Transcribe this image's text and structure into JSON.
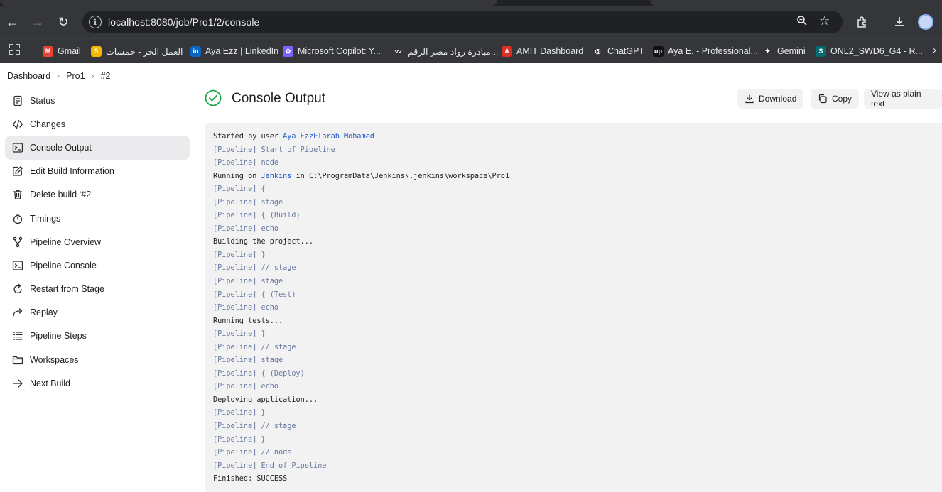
{
  "browser": {
    "url": "localhost:8080/job/Pro1/2/console",
    "bookmarks": [
      {
        "label": "Gmail",
        "fav": "M",
        "color": "#ea4335"
      },
      {
        "label": "العمل الحر - خمسات",
        "fav": "5",
        "color": "#f6b700"
      },
      {
        "label": "Aya Ezz | LinkedIn",
        "fav": "in",
        "color": "#0a66c2"
      },
      {
        "label": "Microsoft Copilot: Y...",
        "fav": "✿",
        "color": "#7b61ff"
      },
      {
        "label": "مبادرة رواد مصر الرقم...",
        "fav": "〰",
        "color": "#35363a"
      },
      {
        "label": "AMIT Dashboard",
        "fav": "A",
        "color": "#d93025"
      },
      {
        "label": "ChatGPT",
        "fav": "◎",
        "color": "#35363a"
      },
      {
        "label": "Aya E. - Professional...",
        "fav": "up",
        "color": "#111111"
      },
      {
        "label": "Gemini",
        "fav": "✦",
        "color": "#35363a"
      },
      {
        "label": "ONL2_SWD6_G4 - R...",
        "fav": "S",
        "color": "#036c70"
      }
    ]
  },
  "breadcrumb": {
    "dashboard": "Dashboard",
    "job": "Pro1",
    "build": "#2"
  },
  "sidebar": {
    "items": [
      {
        "label": "Status",
        "icon": "status-icon",
        "active": false
      },
      {
        "label": "Changes",
        "icon": "code-icon",
        "active": false
      },
      {
        "label": "Console Output",
        "icon": "terminal-icon",
        "active": true
      },
      {
        "label": "Edit Build Information",
        "icon": "edit-icon",
        "active": false
      },
      {
        "label": "Delete build ‘#2’",
        "icon": "trash-icon",
        "active": false
      },
      {
        "label": "Timings",
        "icon": "stopwatch-icon",
        "active": false
      },
      {
        "label": "Pipeline Overview",
        "icon": "branch-icon",
        "active": false
      },
      {
        "label": "Pipeline Console",
        "icon": "terminal-icon",
        "active": false
      },
      {
        "label": "Restart from Stage",
        "icon": "restart-icon",
        "active": false
      },
      {
        "label": "Replay",
        "icon": "replay-icon",
        "active": false
      },
      {
        "label": "Pipeline Steps",
        "icon": "list-icon",
        "active": false
      },
      {
        "label": "Workspaces",
        "icon": "folder-icon",
        "active": false
      },
      {
        "label": "Next Build",
        "icon": "arrow-right-icon",
        "active": false
      }
    ]
  },
  "main": {
    "title": "Console Output",
    "buttons": {
      "download": "Download",
      "copy": "Copy",
      "plain": "View as plain text"
    },
    "console_lines": [
      {
        "parts": [
          {
            "t": "Started by user ",
            "c": ""
          },
          {
            "t": "Aya EzzElarab Mohamed",
            "c": "link"
          }
        ]
      },
      {
        "parts": [
          {
            "t": "[Pipeline] Start of Pipeline",
            "c": "pipe"
          }
        ]
      },
      {
        "parts": [
          {
            "t": "[Pipeline] node",
            "c": "pipe"
          }
        ]
      },
      {
        "parts": [
          {
            "t": "Running on ",
            "c": ""
          },
          {
            "t": "Jenkins",
            "c": "link"
          },
          {
            "t": " in C:\\ProgramData\\Jenkins\\.jenkins\\workspace\\Pro1",
            "c": ""
          }
        ]
      },
      {
        "parts": [
          {
            "t": "[Pipeline] {",
            "c": "pipe"
          }
        ]
      },
      {
        "parts": [
          {
            "t": "[Pipeline] stage",
            "c": "pipe"
          }
        ]
      },
      {
        "parts": [
          {
            "t": "[Pipeline] { (Build)",
            "c": "pipe"
          }
        ]
      },
      {
        "parts": [
          {
            "t": "[Pipeline] echo",
            "c": "pipe"
          }
        ]
      },
      {
        "parts": [
          {
            "t": "Building the project...",
            "c": ""
          }
        ]
      },
      {
        "parts": [
          {
            "t": "[Pipeline] }",
            "c": "pipe"
          }
        ]
      },
      {
        "parts": [
          {
            "t": "[Pipeline] // stage",
            "c": "pipe"
          }
        ]
      },
      {
        "parts": [
          {
            "t": "[Pipeline] stage",
            "c": "pipe"
          }
        ]
      },
      {
        "parts": [
          {
            "t": "[Pipeline] { (Test)",
            "c": "pipe"
          }
        ]
      },
      {
        "parts": [
          {
            "t": "[Pipeline] echo",
            "c": "pipe"
          }
        ]
      },
      {
        "parts": [
          {
            "t": "Running tests...",
            "c": ""
          }
        ]
      },
      {
        "parts": [
          {
            "t": "[Pipeline] }",
            "c": "pipe"
          }
        ]
      },
      {
        "parts": [
          {
            "t": "[Pipeline] // stage",
            "c": "pipe"
          }
        ]
      },
      {
        "parts": [
          {
            "t": "[Pipeline] stage",
            "c": "pipe"
          }
        ]
      },
      {
        "parts": [
          {
            "t": "[Pipeline] { (Deploy)",
            "c": "pipe"
          }
        ]
      },
      {
        "parts": [
          {
            "t": "[Pipeline] echo",
            "c": "pipe"
          }
        ]
      },
      {
        "parts": [
          {
            "t": "Deploying application...",
            "c": ""
          }
        ]
      },
      {
        "parts": [
          {
            "t": "[Pipeline] }",
            "c": "pipe"
          }
        ]
      },
      {
        "parts": [
          {
            "t": "[Pipeline] // stage",
            "c": "pipe"
          }
        ]
      },
      {
        "parts": [
          {
            "t": "[Pipeline] }",
            "c": "pipe"
          }
        ]
      },
      {
        "parts": [
          {
            "t": "[Pipeline] // node",
            "c": "pipe"
          }
        ]
      },
      {
        "parts": [
          {
            "t": "[Pipeline] End of Pipeline",
            "c": "pipe"
          }
        ]
      },
      {
        "parts": [
          {
            "t": "Finished: SUCCESS",
            "c": ""
          }
        ]
      }
    ]
  },
  "colors": {
    "success": "#1ea446",
    "link": "#2559c8",
    "pipeline": "#6779a0"
  }
}
